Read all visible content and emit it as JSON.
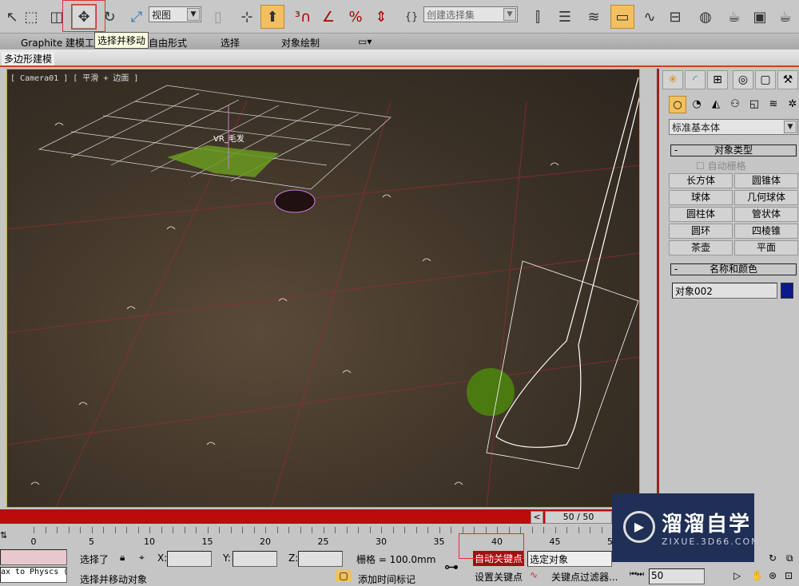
{
  "toolbar": {
    "view_dropdown": "视图",
    "selection_set_placeholder": "创建选择集",
    "icons": [
      "select-icon",
      "rect-region-icon",
      "window-crossing-icon",
      "move-icon",
      "rotate-icon",
      "scale-icon",
      "pivot-icon",
      "snap-3d-icon",
      "angle-snap-icon",
      "percent-snap-icon",
      "spinner-snap-icon",
      "edit-named-sets-icon",
      "mirror-icon",
      "align-icon",
      "layer-icon",
      "scene-explorer-icon",
      "curve-editor-icon",
      "schematic-icon",
      "material-editor-icon",
      "render-setup-icon",
      "render-frame-icon",
      "render-icon"
    ]
  },
  "tooltip": "选择并移动",
  "ribbon": {
    "tabs": [
      "Graphite 建模工具",
      "自由形式",
      "选择",
      "对象绘制"
    ],
    "subtab": "多边形建模"
  },
  "viewport": {
    "label": "[ Camera01 ] [ 平滑 + 边面 ]",
    "object_label": "VR_毛发"
  },
  "command_panel": {
    "tabs": [
      "create-icon",
      "modify-icon",
      "hierarchy-icon",
      "motion-icon",
      "display-icon",
      "utilities-icon"
    ],
    "category": "标准基本体",
    "object_type_title": "对象类型",
    "autogrid_label": "自动栅格",
    "buttons": [
      "长方体",
      "圆锥体",
      "球体",
      "几何球体",
      "圆柱体",
      "管状体",
      "圆环",
      "四棱锥",
      "茶壶",
      "平面"
    ],
    "name_color_title": "名称和颜色",
    "object_name": "对象002",
    "object_color": "#0a1a8a"
  },
  "timeline": {
    "slider": "50 / 50",
    "prev": "<",
    "ticks": [
      "0",
      "5",
      "10",
      "15",
      "20",
      "25",
      "30",
      "35",
      "40",
      "45",
      "50"
    ]
  },
  "status": {
    "script_listener": "ax to Physcs (",
    "selected": "选择了",
    "x_label": "X:",
    "y_label": "Y:",
    "z_label": "Z:",
    "grid": "栅格 = 100.0mm",
    "prompt": "选择并移动对象",
    "add_time_tag": "添加时间标记",
    "auto_key": "自动关键点",
    "set_key": "设置关键点",
    "selected_object": "选定对象",
    "key_filters": "关键点过滤器...",
    "frame": "50"
  },
  "watermark": {
    "text": "溜溜自学",
    "url": "ZIXUE.3D66.COM"
  },
  "colors": {
    "accent_red": "#bb0b0b",
    "highlight": "#f2c060",
    "viewport_bg": "#3b3126"
  }
}
